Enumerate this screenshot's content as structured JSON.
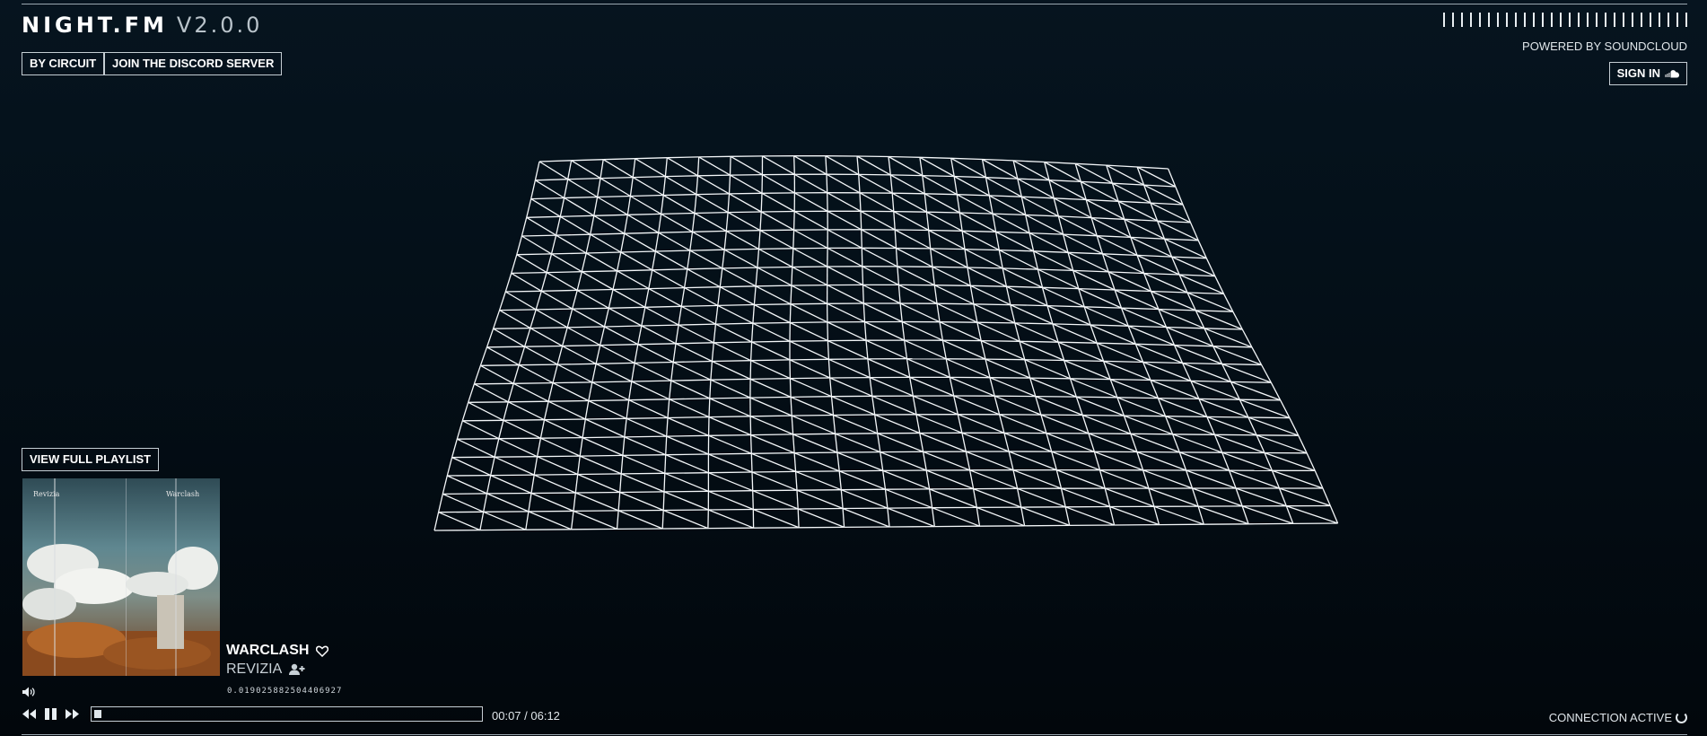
{
  "brand": {
    "name": "NIGHT.FM",
    "version": "V2.0.0"
  },
  "header": {
    "by_circuit_label": "BY CIRCUIT",
    "discord_label": "JOIN THE DISCORD SERVER",
    "powered_by": "POWERED BY SOUNDCLOUD",
    "sign_in_label": "SIGN IN"
  },
  "playlist": {
    "view_full_label": "VIEW FULL PLAYLIST"
  },
  "now_playing": {
    "title": "WARCLASH",
    "artist": "REVIZIA",
    "random_value": "0.019025882504406927",
    "album_art_text_left": "Revizia",
    "album_art_text_right": "Warclash"
  },
  "player": {
    "time": "00:07 / 06:12",
    "progress_fraction": 0.019
  },
  "status": {
    "connection": "CONNECTION ACTIVE"
  },
  "icons": {
    "heart": "heart-icon",
    "add_user": "add-user-icon",
    "volume": "volume-icon",
    "rewind": "rewind-icon",
    "pause": "pause-icon",
    "forward": "fast-forward-icon",
    "cloud": "cloud-icon",
    "spinner": "spinner-icon"
  },
  "colors": {
    "background": "#041019",
    "foreground": "#e8eef2",
    "mesh": "#f4f7f9"
  }
}
